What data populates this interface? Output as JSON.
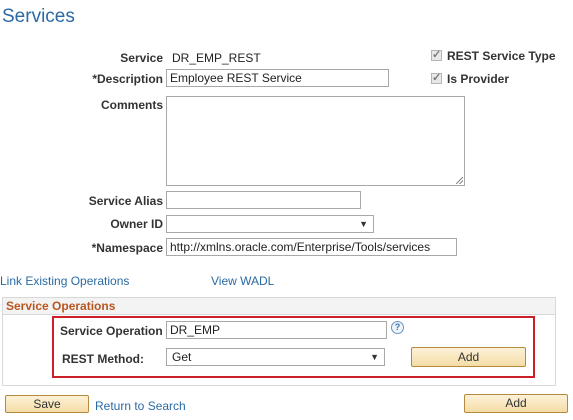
{
  "page": {
    "title": "Services"
  },
  "form": {
    "service_label": "Service",
    "service_value": "DR_EMP_REST",
    "description_label": "*Description",
    "description_value": "Employee REST Service",
    "comments_label": "Comments",
    "comments_value": "",
    "alias_label": "Service Alias",
    "alias_value": "",
    "owner_label": "Owner ID",
    "owner_value": "",
    "namespace_label": "*Namespace",
    "namespace_value": "http://xmlns.oracle.com/Enterprise/Tools/services",
    "rest_service_type_label": "REST Service Type",
    "rest_service_type_checked": true,
    "is_provider_label": "Is Provider",
    "is_provider_checked": true
  },
  "links": {
    "link_existing": "Link Existing Operations",
    "view_wadl": "View WADL"
  },
  "operations": {
    "section_title": "Service Operations",
    "service_operation_label": "Service Operation",
    "service_operation_value": "DR_EMP",
    "help_glyph": "?",
    "rest_method_label": "REST Method:",
    "rest_method_value": "Get",
    "add_label": "Add"
  },
  "footer": {
    "save_label": "Save",
    "return_label": "Return to Search",
    "add_label": "Add"
  },
  "colors": {
    "title": "#2b6aa4",
    "section_title": "#b8561f",
    "highlight_box": "#cc1f2a",
    "button_fill": "#f4dca5"
  }
}
